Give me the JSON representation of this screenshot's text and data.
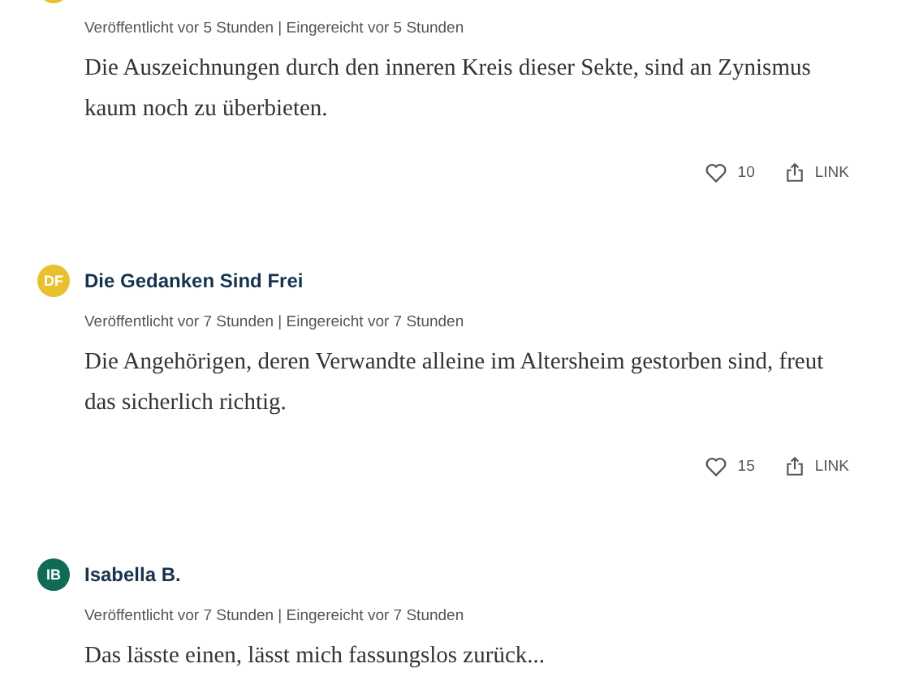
{
  "comments": [
    {
      "color": "#e8c12e",
      "meta": "Veröffentlicht vor 5 Stunden | Eingereicht vor 5 Stunden",
      "text": "Die Auszeichnungen durch den inneren Kreis dieser Sekte, sind an Zynismus kaum noch zu überbieten.",
      "likes": "10",
      "link": "LINK"
    },
    {
      "color": "#e8c12e",
      "initials": "DF",
      "author": "Die Gedanken Sind Frei",
      "meta": "Veröffentlicht vor 7 Stunden | Eingereicht vor 7 Stunden",
      "text": "Die Angehörigen, deren Verwandte alleine im Altersheim gestorben sind, freut das sicherlich richtig.",
      "likes": "15",
      "link": "LINK"
    },
    {
      "color": "#0f6b55",
      "initials": "IB",
      "author": "Isabella B.",
      "meta": "Veröffentlicht vor 7 Stunden | Eingereicht vor 7 Stunden",
      "text": "Das lässte einen, lässt mich fassungslos zurück..."
    }
  ]
}
